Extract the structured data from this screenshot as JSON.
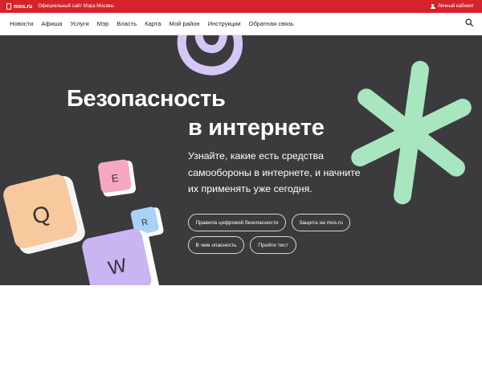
{
  "topbar": {
    "logo_text": "mos.ru",
    "official_text": "Официальный сайт Мэра Москвы",
    "cabinet_label": "Личный кабинет",
    "color": "#d5232c"
  },
  "nav": {
    "items": [
      {
        "label": "Новости"
      },
      {
        "label": "Афиша"
      },
      {
        "label": "Услуги"
      },
      {
        "label": "Мэр"
      },
      {
        "label": "Власть"
      },
      {
        "label": "Карта"
      },
      {
        "label": "Мой район"
      },
      {
        "label": "Инструкции"
      },
      {
        "label": "Обратная связь"
      }
    ],
    "search_icon": "search-icon"
  },
  "hero": {
    "title_line1": "Безопасность",
    "title_line2": "в интернете",
    "description": "Узнайте, какие есть средства самообороны в интернете, и начните их применять уже сегодня.",
    "background": "#3b3b3e",
    "buttons": [
      {
        "label": "Правила цифровой безопасности"
      },
      {
        "label": "Защита на mos.ru"
      },
      {
        "label": "В чем опасность"
      },
      {
        "label": "Пройти тест"
      }
    ],
    "keys": {
      "q": "Q",
      "e": "E",
      "r": "R",
      "w": "W"
    },
    "decor_colors": {
      "asterisk": "#a8e6bf",
      "at_sign": "#d6c6f5",
      "key_q": "#f8c99d",
      "key_e": "#f5a8c0",
      "key_r": "#a9d3f5",
      "key_w": "#c9b5f2"
    }
  }
}
